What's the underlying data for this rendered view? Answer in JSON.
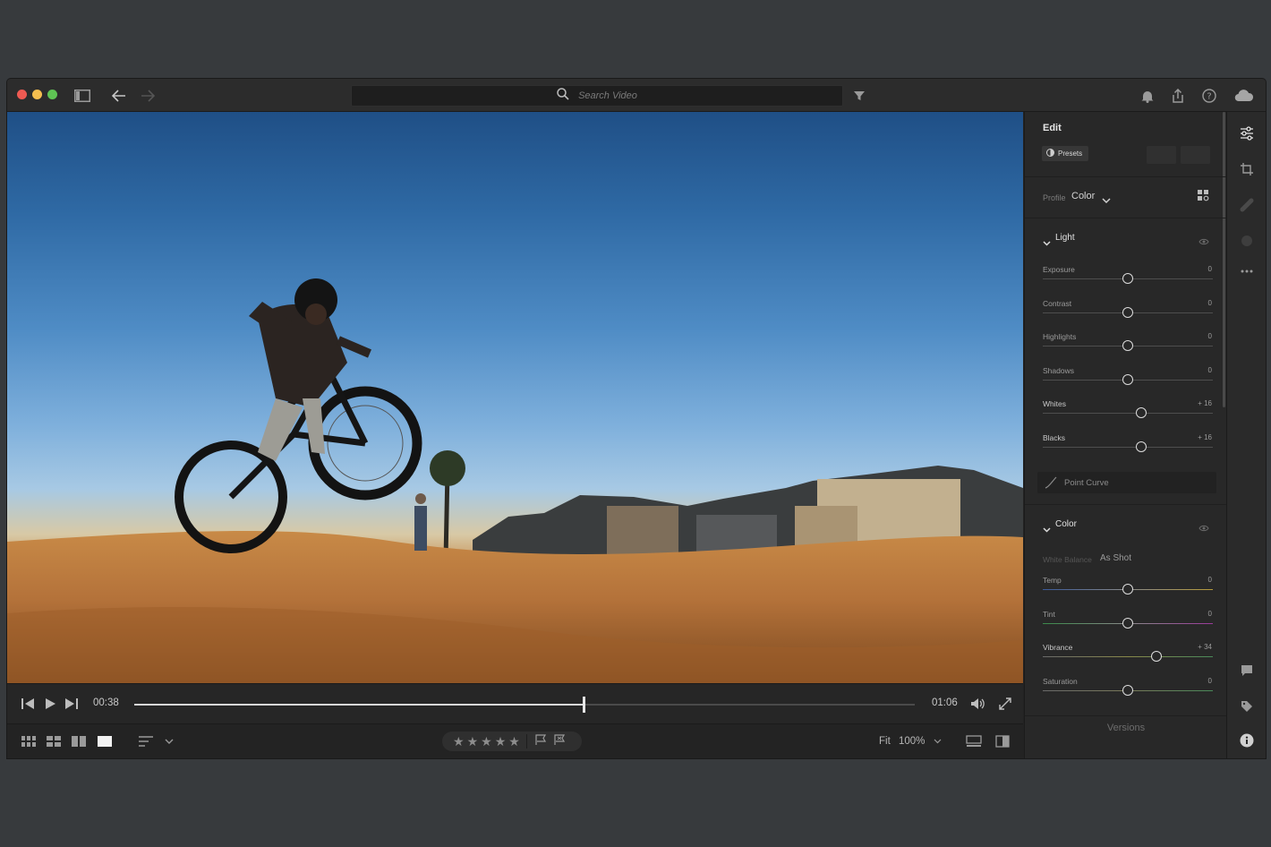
{
  "search": {
    "placeholder": "Search Video"
  },
  "playback": {
    "current_time": "00:38",
    "duration": "01:06",
    "progress": 0.576
  },
  "bottom": {
    "zoom_label": "Fit",
    "zoom_value": "100%",
    "rating_stars": 5
  },
  "panel": {
    "title": "Edit",
    "presets_label": "Presets",
    "profile_label": "Profile",
    "profile_value": "Color",
    "light_title": "Light",
    "color_title": "Color",
    "point_curve_label": "Point Curve",
    "white_balance_label": "White Balance",
    "white_balance_value": "As Shot",
    "versions_label": "Versions",
    "light_sliders": [
      {
        "label": "Exposure",
        "value": "0",
        "fraction": 0.5
      },
      {
        "label": "Contrast",
        "value": "0",
        "fraction": 0.5
      },
      {
        "label": "Highlights",
        "value": "0",
        "fraction": 0.5
      },
      {
        "label": "Shadows",
        "value": "0",
        "fraction": 0.5
      },
      {
        "label": "Whites",
        "value": "+ 16",
        "fraction": 0.58
      },
      {
        "label": "Blacks",
        "value": "+ 16",
        "fraction": 0.58
      }
    ],
    "color_sliders": [
      {
        "label": "Temp",
        "value": "0",
        "fraction": 0.5
      },
      {
        "label": "Tint",
        "value": "0",
        "fraction": 0.5
      },
      {
        "label": "Vibrance",
        "value": "+ 34",
        "fraction": 0.67
      },
      {
        "label": "Saturation",
        "value": "0",
        "fraction": 0.5
      }
    ]
  },
  "colors": {
    "accent_knob": "#dcdcdc",
    "traffic_red": "#ee5a52",
    "traffic_yellow": "#f4be4f",
    "traffic_green": "#5fc454"
  },
  "icons": [
    "sidebar-toggle-icon",
    "back-arrow-icon",
    "forward-arrow-icon",
    "search-icon",
    "filter-icon",
    "bell-icon",
    "share-icon",
    "help-icon",
    "cloud-icon",
    "edit-sliders-icon",
    "crop-icon",
    "healing-brush-icon",
    "mask-icon",
    "more-icon",
    "comment-icon",
    "tag-icon",
    "info-icon"
  ]
}
